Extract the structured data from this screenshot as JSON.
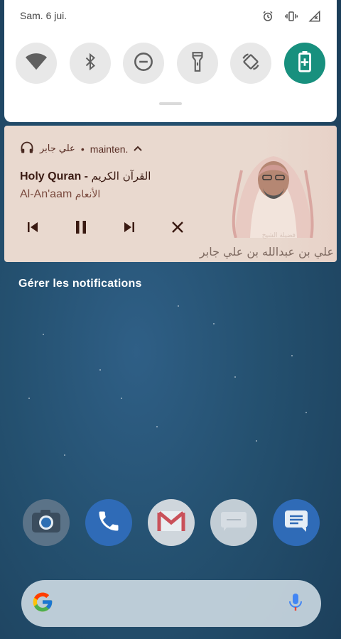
{
  "status_bar": {
    "date": "Sam. 6 jui."
  },
  "quick_settings": {
    "tiles": [
      {
        "id": "wifi",
        "icon": "wifi-icon",
        "active": false
      },
      {
        "id": "bluetooth",
        "icon": "bluetooth-icon",
        "active": false
      },
      {
        "id": "dnd",
        "icon": "do-not-disturb-icon",
        "active": false
      },
      {
        "id": "flashlight",
        "icon": "flashlight-icon",
        "active": false
      },
      {
        "id": "auto-rotate",
        "icon": "rotate-icon",
        "active": false
      },
      {
        "id": "battery-saver",
        "icon": "battery-saver-icon",
        "active": true
      }
    ],
    "active_color": "#18907e"
  },
  "media": {
    "app_name": "علي جابر",
    "dot": "•",
    "time": "mainten.",
    "title_en": "Holy Quran -",
    "title_ar": "القرآن الكريم",
    "subtitle_en": "Al-An'aam",
    "subtitle_ar": "الأنعام",
    "art_caption_small": "فضيلة الشيخ",
    "art_caption": "علي بن عبدالله بن علي جابر",
    "background_color": "#e9d9cf"
  },
  "manage_notifications": "Gérer les notifications",
  "dock": {
    "apps": [
      {
        "name": "Camera",
        "icon": "camera-icon"
      },
      {
        "name": "Phone",
        "icon": "phone-icon"
      },
      {
        "name": "Gmail",
        "icon": "gmail-icon"
      },
      {
        "name": "Messages",
        "icon": "messages-icon"
      },
      {
        "name": "Messages 2",
        "icon": "chat-icon"
      }
    ]
  },
  "search": {
    "placeholder": ""
  }
}
